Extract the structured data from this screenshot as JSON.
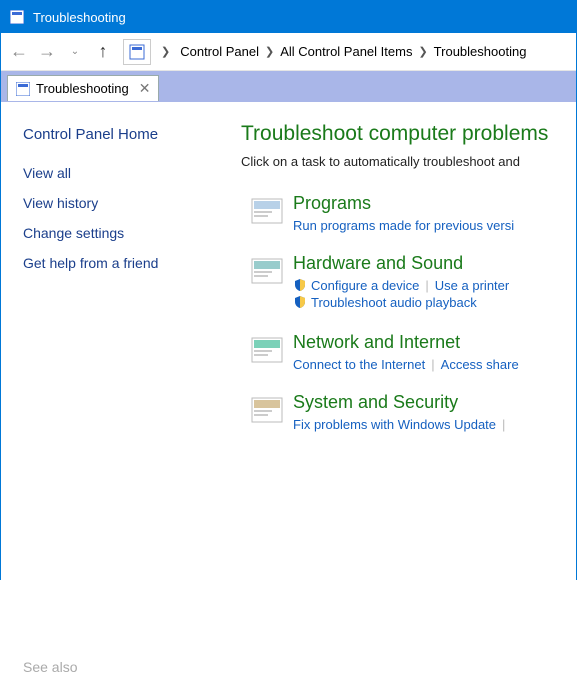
{
  "window": {
    "title": "Troubleshooting"
  },
  "breadcrumbs": {
    "items": [
      "Control Panel",
      "All Control Panel Items",
      "Troubleshooting"
    ]
  },
  "tab": {
    "label": "Troubleshooting"
  },
  "sidebar": {
    "home": "Control Panel Home",
    "links": [
      "View all",
      "View history",
      "Change settings",
      "Get help from a friend"
    ],
    "see_also": "See also"
  },
  "main": {
    "heading": "Troubleshoot computer problems",
    "sub": "Click on a task to automatically troubleshoot and",
    "categories": [
      {
        "title": "Programs",
        "links": [
          {
            "label": "Run programs made for previous versi",
            "shield": false
          }
        ]
      },
      {
        "title": "Hardware and Sound",
        "links": [
          {
            "label": "Configure a device",
            "shield": true
          },
          {
            "label": "Use a printer",
            "shield": false
          },
          {
            "label_newline": true
          },
          {
            "label": "Troubleshoot audio playback",
            "shield": true
          }
        ]
      },
      {
        "title": "Network and Internet",
        "links": [
          {
            "label": "Connect to the Internet",
            "shield": false
          },
          {
            "label": "Access share",
            "shield": false
          }
        ]
      },
      {
        "title": "System and Security",
        "links": [
          {
            "label": "Fix problems with Windows Update",
            "shield": false
          },
          {
            "label": "",
            "shield": false
          }
        ]
      }
    ]
  }
}
